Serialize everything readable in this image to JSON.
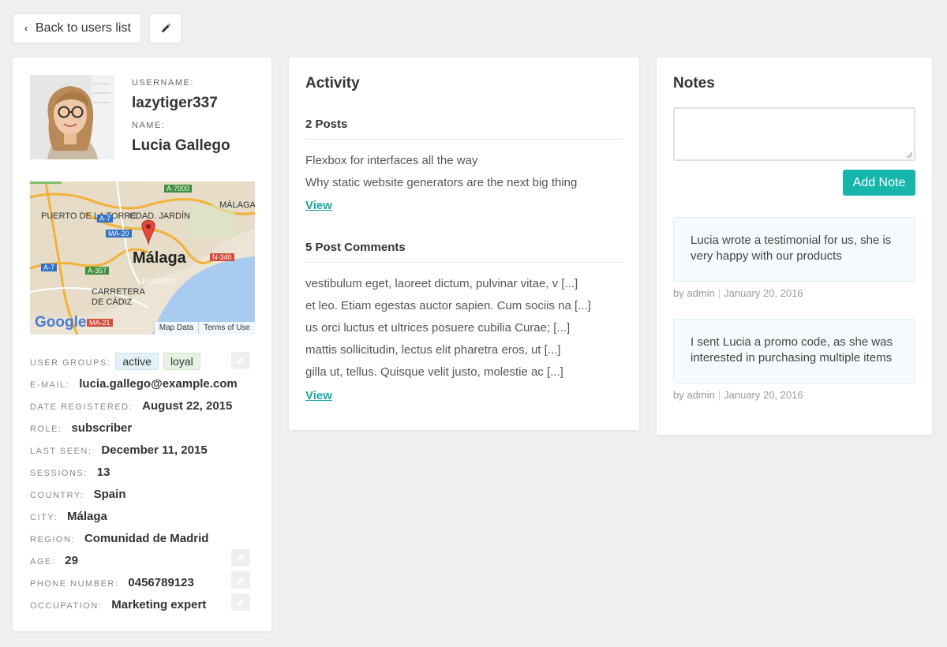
{
  "toolbar": {
    "back_label": "Back to users list"
  },
  "profile": {
    "username_label": "USERNAME:",
    "username": "lazytiger337",
    "name_label": "NAME:",
    "name": "Lucia Gallego",
    "map": {
      "city_label": "Málaga",
      "places": [
        "PUERTO DE LA TORRE",
        "CDAD. JARDÍN",
        "MÁLAGA",
        "PUERTO",
        "CARRETERA DE CÁDIZ"
      ],
      "roads": [
        "A-7000",
        "A-7",
        "MA-20",
        "N-340",
        "A-357",
        "A-7",
        "MA-21"
      ],
      "footer_map_data": "Map Data",
      "footer_terms": "Terms of Use",
      "logo": "Google"
    },
    "details": {
      "groups_label": "USER GROUPS:",
      "groups": [
        "active",
        "loyal"
      ],
      "email_label": "E-MAIL:",
      "email": "lucia.gallego@example.com",
      "registered_label": "DATE REGISTERED:",
      "registered": "August 22, 2015",
      "role_label": "ROLE:",
      "role": "subscriber",
      "last_seen_label": "LAST SEEN:",
      "last_seen": "December 11, 2015",
      "sessions_label": "SESSIONS:",
      "sessions": "13",
      "country_label": "COUNTRY:",
      "country": "Spain",
      "city_label": "CITY:",
      "city": "Málaga",
      "region_label": "REGION:",
      "region": "Comunidad de Madrid",
      "age_label": "AGE:",
      "age": "29",
      "phone_label": "PHONE NUMBER:",
      "phone": "0456789123",
      "occupation_label": "OCCUPATION:",
      "occupation": "Marketing expert"
    }
  },
  "activity": {
    "title": "Activity",
    "posts_title": "2 Posts",
    "posts": [
      "Flexbox for interfaces all the way",
      "Why static website generators are the next big thing"
    ],
    "posts_view": "View",
    "comments_title": "5 Post Comments",
    "comments": [
      "vestibulum eget, laoreet dictum, pulvinar vitae, v [...]",
      "et leo. Etiam egestas auctor sapien. Cum sociis na [...]",
      "us orci luctus et ultrices posuere cubilia Curae; [...]",
      "mattis sollicitudin, lectus elit pharetra eros, ut [...]",
      "gilla ut, tellus. Quisque velit justo, molestie ac [...]"
    ],
    "comments_view": "View"
  },
  "notes": {
    "title": "Notes",
    "input_value": "",
    "add_label": "Add Note",
    "items": [
      {
        "text": "Lucia wrote a testimonial for us, she is very happy with our products",
        "author": "by admin",
        "date": "January 20, 2016"
      },
      {
        "text": "I sent Lucia a promo code, as she was interested in purchasing multiple items",
        "author": "by admin",
        "date": "January 20, 2016"
      }
    ]
  },
  "colors": {
    "accent": "#18b5ab",
    "link": "#1aa6a6",
    "background": "#efefef"
  }
}
